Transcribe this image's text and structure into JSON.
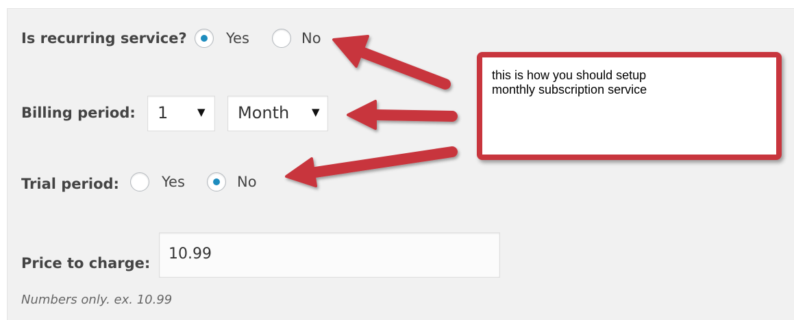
{
  "form": {
    "recurring": {
      "label": "Is recurring service?",
      "yes": "Yes",
      "no": "No",
      "selected": "Yes"
    },
    "billing": {
      "label": "Billing period:",
      "count": "1",
      "unit": "Month"
    },
    "trial": {
      "label": "Trial period:",
      "yes": "Yes",
      "no": "No",
      "selected": "No"
    },
    "price": {
      "label": "Price to charge:",
      "value": "10.99",
      "help": "Numbers only. ex. 10.99"
    }
  },
  "annotation": {
    "text_line1": "this is how you should setup",
    "text_line2": "monthly subscription service",
    "color": "#c8353d"
  },
  "colors": {
    "panel_bg": "#f1f1f1",
    "radio_checked": "#1e8cbe",
    "label_text": "#444444"
  }
}
